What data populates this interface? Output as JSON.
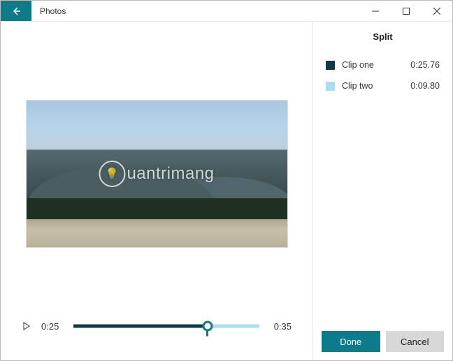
{
  "window": {
    "title": "Photos"
  },
  "player": {
    "current_time": "0:25",
    "total_time": "0:35",
    "split_position_pct": 72
  },
  "watermark": {
    "text": "uantrimang"
  },
  "panel": {
    "title": "Split",
    "clips": [
      {
        "name": "Clip one",
        "duration": "0:25.76",
        "color": "#0e3a46"
      },
      {
        "name": "Clip two",
        "duration": "0:09.80",
        "color": "#a7dff4"
      }
    ],
    "done_label": "Done",
    "cancel_label": "Cancel"
  },
  "colors": {
    "accent": "#0d7b8a"
  }
}
